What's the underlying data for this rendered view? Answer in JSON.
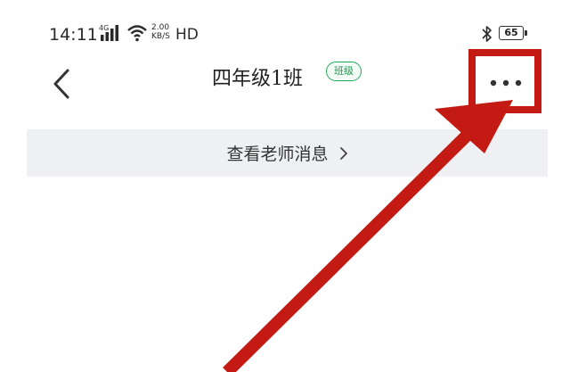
{
  "status_bar": {
    "time": "14:11",
    "network": "4G",
    "speed_value": "2.00",
    "speed_unit": "KB/S",
    "hd": "HD",
    "battery": "65"
  },
  "header": {
    "title": "四年级1班",
    "badge": "班级",
    "back_icon": "chevron-left-icon",
    "more_icon": "more-horizontal-icon"
  },
  "banner": {
    "label": "查看老师消息"
  },
  "annotation": {
    "color": "#c41a14"
  },
  "colors": {
    "badge_green": "#1f9a4f",
    "banner_bg": "#eef0f3"
  }
}
